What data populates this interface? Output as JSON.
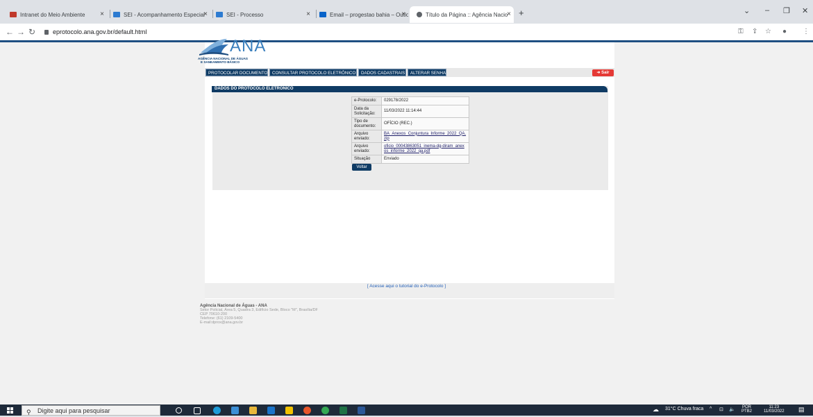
{
  "browser": {
    "tabs": [
      {
        "title": "Intranet do Meio Ambiente",
        "color": "#c0392b"
      },
      {
        "title": "SEI - Acompanhamento Especial",
        "color": "#2d7bd1"
      },
      {
        "title": "SEI - Processo",
        "color": "#2d7bd1"
      },
      {
        "title": "Email – progestao bahia – Outlo",
        "color": "#0a64c9"
      },
      {
        "title": "Título da Página :: Agência Nacio",
        "color": "#5f6368"
      }
    ],
    "new_tab": "+",
    "url": "eprotocolo.ana.gov.br/default.html"
  },
  "logo": {
    "word": "ANA",
    "subtitle_line1": "AGÊNCIA NACIONAL DE ÁGUAS",
    "subtitle_line2": "E SANEAMENTO BÁSICO"
  },
  "menu": {
    "items": [
      "PROTOCOLAR DOCUMENTO",
      "CONSULTAR PROTOCOLO ELETRÔNICO",
      "DADOS CADASTRAIS",
      "ALTERAR SENHA"
    ],
    "sair": "Sair"
  },
  "panel": {
    "title": "DADOS DO PROTOCOLO ELETRÔNICO",
    "rows": [
      {
        "label": "e-Protocolo:",
        "value": "029178/2022"
      },
      {
        "label": "Data da Solicitação:",
        "value": "11/03/2022 11:14:44"
      },
      {
        "label": "Tipo de documento:",
        "value": "OFÍCIO (REC.)"
      },
      {
        "label": "Arquivo enviado:",
        "value": "BA_Anexos_Conjuntura_Informe_2022_QA.zip"
      },
      {
        "label": "Arquivo enviado:",
        "value": "oficio_00043863051_inema-dg-diram_anexos_informe_2022_qa.pdf"
      },
      {
        "label": "Situação",
        "value": "Enviado"
      }
    ],
    "back_button": "Voltar"
  },
  "tutorial_link": "[ Acesse aqui o tutorial do e-Protocolo ]",
  "footer": {
    "org": "Agência Nacional de Águas - ANA",
    "line1": "Setor Policial, Área 5, Quadra 3, Edifício Sede, Bloco \"M\", Brasília/DF",
    "line2": "CEP 70610-200",
    "line3": "Telefone: (61) 2109-5400",
    "line4": "E-mail:dprox@ana.gov.br"
  },
  "taskbar": {
    "search_placeholder": "Digite aqui para pesquisar",
    "weather": "31°C  Chuva fraca",
    "lang": "POR",
    "lang2": "PTB2",
    "time": "11:23",
    "date": "11/03/2022"
  }
}
